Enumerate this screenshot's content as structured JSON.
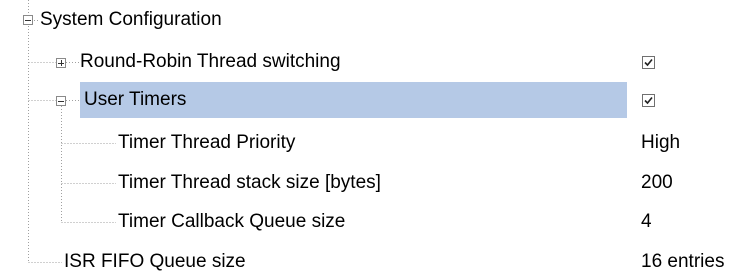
{
  "tree": {
    "root": {
      "label": "System Configuration",
      "expanded": true
    },
    "round_robin": {
      "label": "Round-Robin Thread switching",
      "expanded": false,
      "checked": true
    },
    "user_timers": {
      "label": "User Timers",
      "expanded": true,
      "checked": true
    },
    "timer_priority": {
      "label": "Timer Thread Priority",
      "value": "High"
    },
    "timer_stack": {
      "label": "Timer Thread stack size [bytes]",
      "value": "200"
    },
    "timer_queue": {
      "label": "Timer Callback Queue size",
      "value": "4"
    },
    "isr_fifo": {
      "label": "ISR FIFO Queue size",
      "value": "16 entries"
    }
  },
  "colors": {
    "selection": "#b5c9e6",
    "tree_lines": "#a0a0a0"
  },
  "icons": {
    "collapse": "minus-box",
    "expand": "plus-box",
    "check": "checkmark"
  }
}
